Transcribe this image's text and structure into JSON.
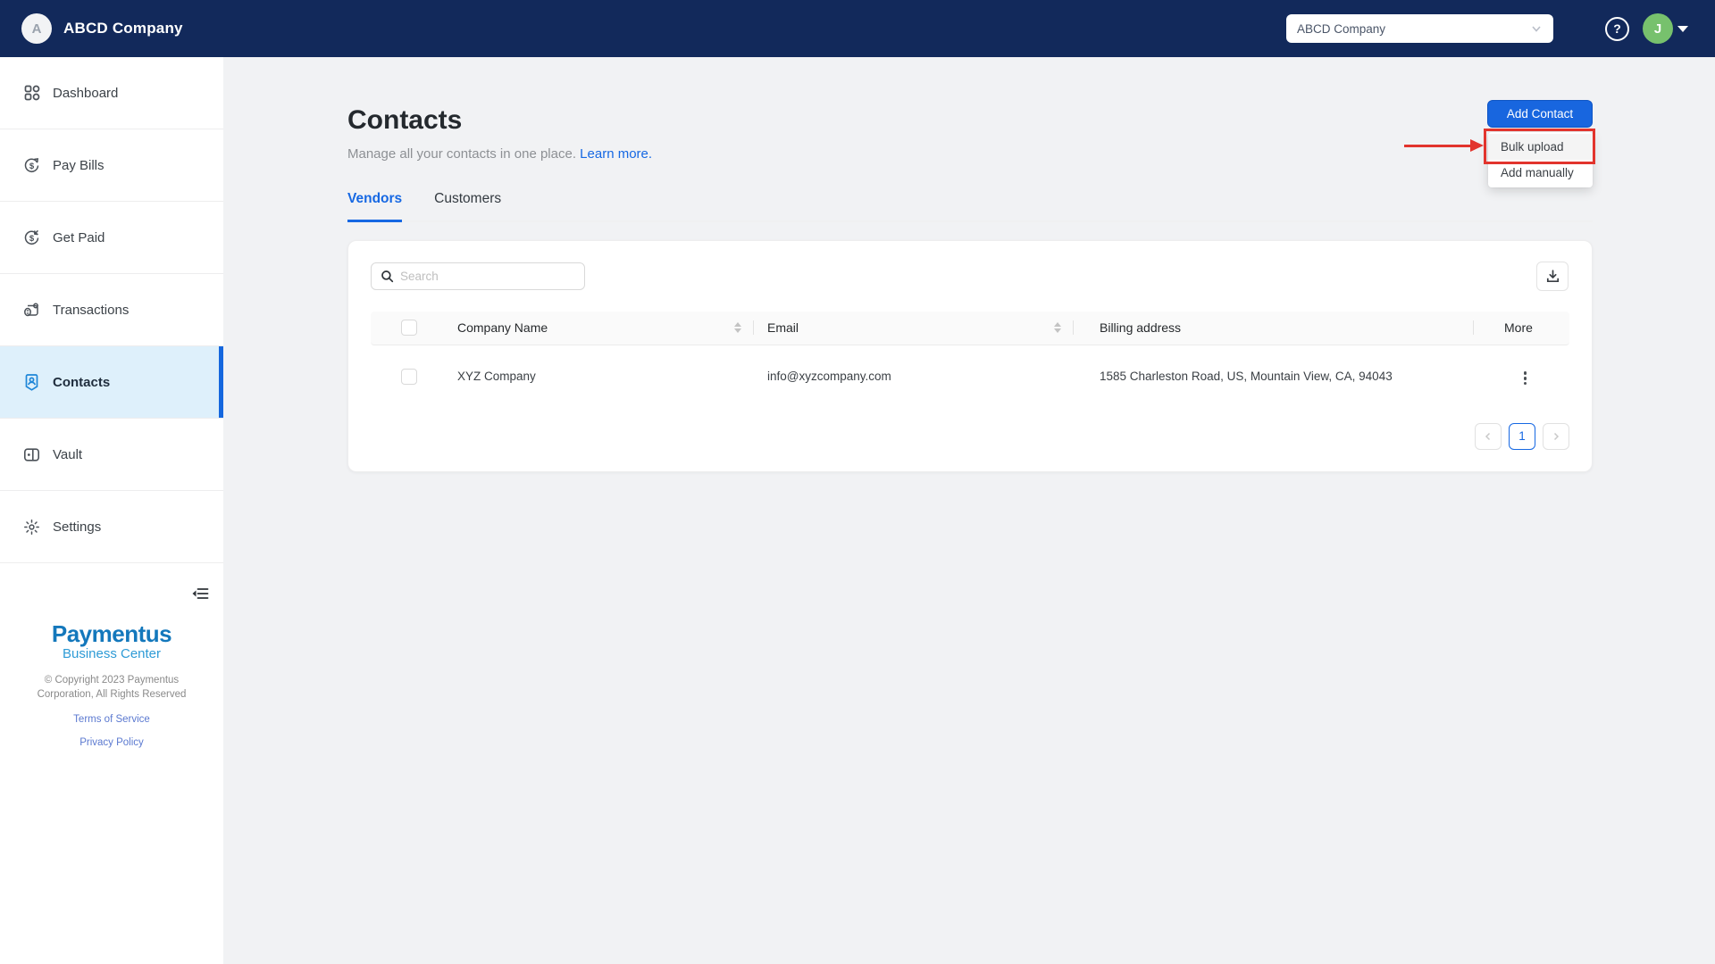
{
  "navbar": {
    "brand": "ABCD Company",
    "brand_avatar_letter": "A",
    "company_select_value": "ABCD Company",
    "user_avatar_letter": "J"
  },
  "sidebar": {
    "items": [
      {
        "label": "Dashboard"
      },
      {
        "label": "Pay Bills"
      },
      {
        "label": "Get Paid"
      },
      {
        "label": "Transactions"
      },
      {
        "label": "Contacts",
        "active": true
      },
      {
        "label": "Vault"
      },
      {
        "label": "Settings"
      }
    ],
    "footer": {
      "logo_title": "Paymentus",
      "logo_subtitle": "Business Center",
      "copyright_line1": "© Copyright 2023 Paymentus",
      "copyright_line2": "Corporation, All Rights Reserved",
      "terms_link": "Terms of Service",
      "privacy_link": "Privacy Policy"
    }
  },
  "page": {
    "title": "Contacts",
    "subtitle": "Manage all your contacts in one place.",
    "learn_more": "Learn more.",
    "tabs": [
      {
        "label": "Vendors",
        "active": true
      },
      {
        "label": "Customers",
        "active": false
      }
    ],
    "add_contact_button": "Add Contact",
    "menu_items": [
      "Bulk upload",
      "Add manually"
    ]
  },
  "table": {
    "search_placeholder": "Search",
    "columns": [
      "Company Name",
      "Email",
      "Billing address",
      "More"
    ],
    "rows": [
      {
        "company": "XYZ Company",
        "email": "info@xyzcompany.com",
        "billing": "1585 Charleston Road, US, Mountain View, CA, 94043"
      }
    ],
    "pagination": {
      "current": "1"
    }
  },
  "colors": {
    "navbar_bg": "#12295b",
    "primary_blue": "#1668e3",
    "button_blue": "#1866df",
    "active_item_bg": "#def0fb",
    "active_bar": "#1567de",
    "contacts_icon_blue": "#1e86d8",
    "annotation_red": "#e2342d",
    "avatar_green": "#77c16d",
    "paymentus_blue": "#1478bc",
    "business_center_blue": "#2e9bd6",
    "footer_link_blue": "#5b79d0",
    "page_bg": "#f1f2f4",
    "table_header_bg": "#fafafa"
  }
}
